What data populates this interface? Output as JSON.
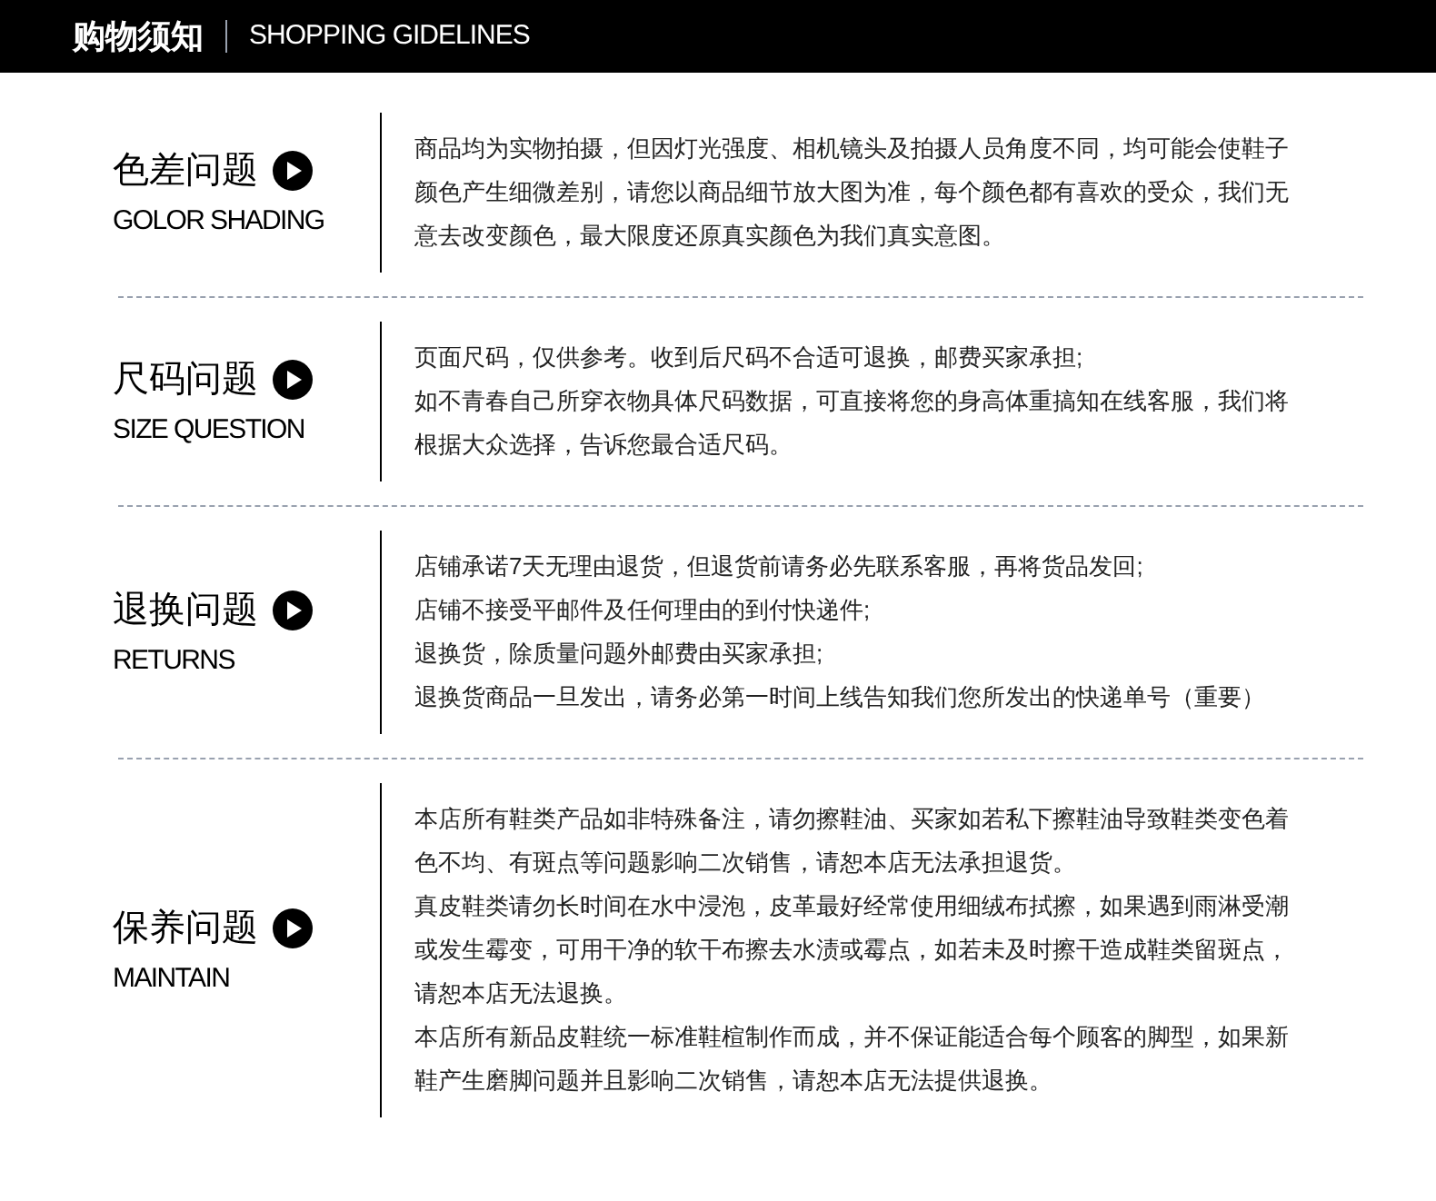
{
  "header": {
    "title": "购物须知",
    "subtitle": "SHOPPING GIDELINES"
  },
  "sections": [
    {
      "title": "色差问题",
      "subtitle": "GOLOR SHADING",
      "paragraphs": [
        "商品均为实物拍摄，但因灯光强度、相机镜头及拍摄人员角度不同，均可能会使鞋子颜色产生细微差别，请您以商品细节放大图为准，每个颜色都有喜欢的受众，我们无意去改变颜色，最大限度还原真实颜色为我们真实意图。"
      ]
    },
    {
      "title": "尺码问题",
      "subtitle": "SIZE QUESTION",
      "paragraphs": [
        "页面尺码，仅供参考。收到后尺码不合适可退换，邮费买家承担;",
        "如不青春自己所穿衣物具体尺码数据，可直接将您的身高体重搞知在线客服，我们将根据大众选择，告诉您最合适尺码。"
      ]
    },
    {
      "title": "退换问题",
      "subtitle": "RETURNS",
      "paragraphs": [
        "店铺承诺7天无理由退货，但退货前请务必先联系客服，再将货品发回;",
        "店铺不接受平邮件及任何理由的到付快递件;",
        "退换货，除质量问题外邮费由买家承担;",
        "退换货商品一旦发出，请务必第一时间上线告知我们您所发出的快递单号（重要）"
      ]
    },
    {
      "title": "保养问题",
      "subtitle": "MAINTAIN",
      "paragraphs": [
        "本店所有鞋类产品如非特殊备注，请勿擦鞋油、买家如若私下擦鞋油导致鞋类变色着色不均、有斑点等问题影响二次销售，请恕本店无法承担退货。",
        "真皮鞋类请勿长时间在水中浸泡，皮革最好经常使用细绒布拭擦，如果遇到雨淋受潮或发生霉变，可用干净的软干布擦去水渍或霉点，如若未及时擦干造成鞋类留斑点，请恕本店无法退换。",
        "本店所有新品皮鞋统一标准鞋楦制作而成，并不保证能适合每个顾客的脚型，如果新鞋产生磨脚问题并且影响二次销售，请恕本店无法提供退换。"
      ]
    }
  ]
}
